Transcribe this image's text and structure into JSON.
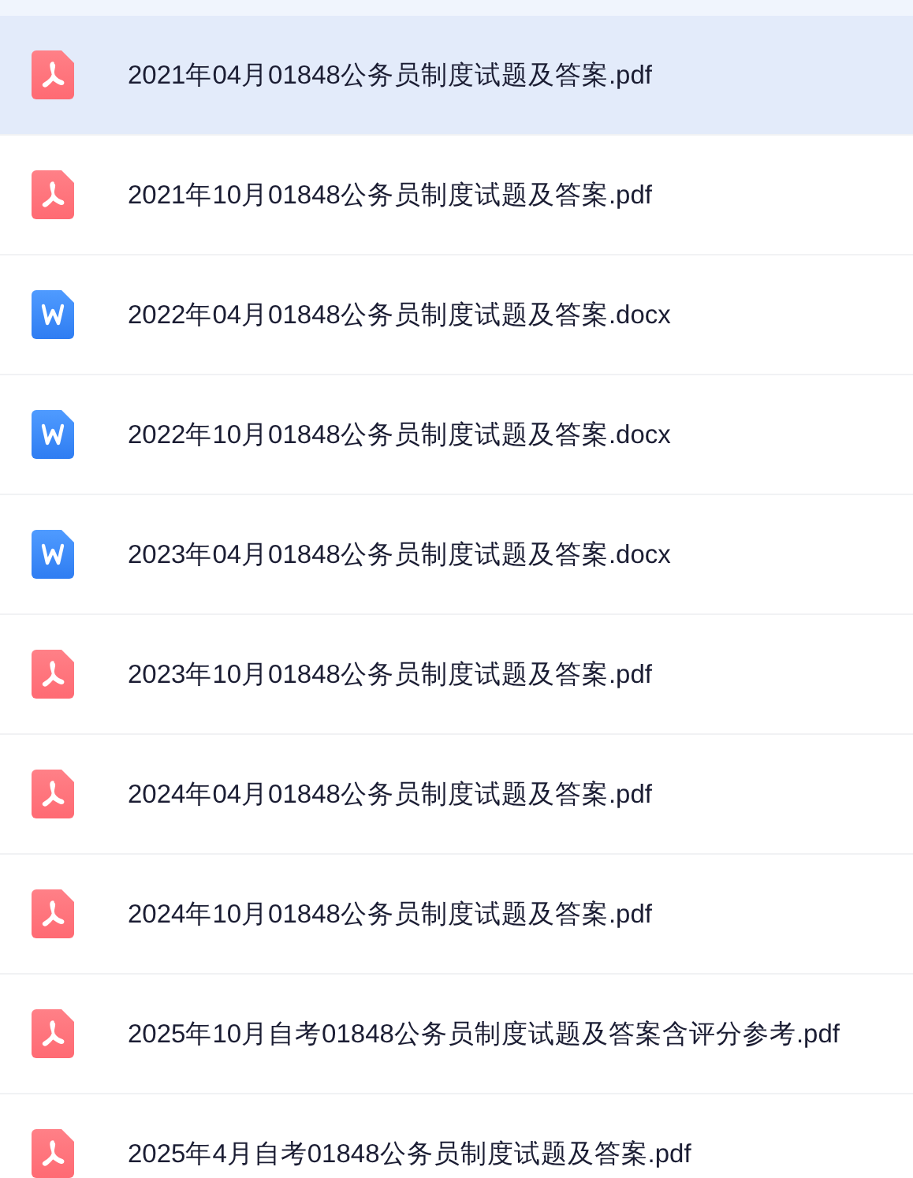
{
  "files": [
    {
      "name": "2021年04月01848公务员制度试题及答案.pdf",
      "kind": "pdf",
      "selected": true
    },
    {
      "name": "2021年10月01848公务员制度试题及答案.pdf",
      "kind": "pdf",
      "selected": false
    },
    {
      "name": "2022年04月01848公务员制度试题及答案.docx",
      "kind": "word",
      "selected": false
    },
    {
      "name": "2022年10月01848公务员制度试题及答案.docx",
      "kind": "word",
      "selected": false
    },
    {
      "name": "2023年04月01848公务员制度试题及答案.docx",
      "kind": "word",
      "selected": false
    },
    {
      "name": "2023年10月01848公务员制度试题及答案.pdf",
      "kind": "pdf",
      "selected": false
    },
    {
      "name": "2024年04月01848公务员制度试题及答案.pdf",
      "kind": "pdf",
      "selected": false
    },
    {
      "name": "2024年10月01848公务员制度试题及答案.pdf",
      "kind": "pdf",
      "selected": false
    },
    {
      "name": "2025年10月自考01848公务员制度试题及答案含评分参考.pdf",
      "kind": "pdf",
      "selected": false
    },
    {
      "name": "2025年4月自考01848公务员制度试题及答案.pdf",
      "kind": "pdf",
      "selected": false
    }
  ]
}
